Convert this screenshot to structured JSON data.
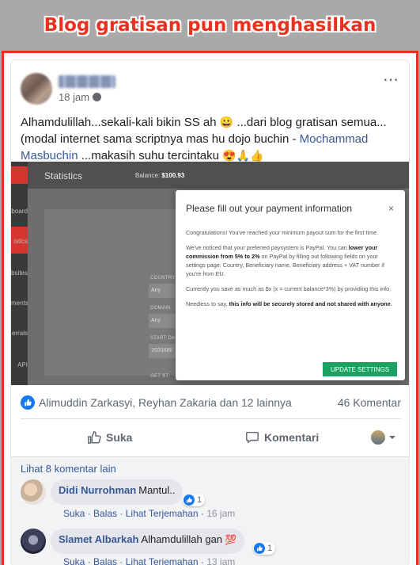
{
  "banner": {
    "title": "Blog gratisan pun menghasilkan"
  },
  "post": {
    "time": "18 jam",
    "more_icon": "⋯",
    "text_before": "Alhamdulillah...sekali-kali bikin SS ah ",
    "text_mid": " ...dari blog gratisan semua... (modal internet sama scriptnya mas hu dojo buchin - ",
    "mention": "Mochammad Masbuchin",
    "text_after": " ...makasih suhu tercintaku ",
    "emoji_1": "😀",
    "emoji_2": "😍🙏👍"
  },
  "screenshot": {
    "page_title": "Statistics",
    "balance_label": "Balance: ",
    "balance_value": "$100.93",
    "sidebar": [
      "board",
      "istics",
      "bsites",
      "ments",
      "errals",
      "API"
    ],
    "fields": [
      "COUNTRY",
      "DOMAIN",
      "START DA"
    ],
    "field_values": [
      "Any",
      "Any",
      "2020/06/"
    ],
    "get_label": "GET ST",
    "modal": {
      "title": "Please fill out your payment information",
      "close": "×",
      "p1": "Congratulations! You've reached your minimum payout sum for the first time.",
      "p2a": "We've noticed that your preferred paysystem is PayPal. You can ",
      "p2b": "lower your commission from 5% to 2%",
      "p2c": " on PayPal by filling out following fields on your settings page: Country, Beneficiary name, Beneficiary address + VAT number if you're from EU.",
      "p3": "Currently you save as much as $x (x = current balance*3%) by providing this info.",
      "p4a": "Needless to say, ",
      "p4b": "this info will be securely stored and not shared with anyone",
      "p4c": ".",
      "button": "UPDATE SETTINGS"
    }
  },
  "reactions": {
    "names": "Alimuddin Zarkasyi, Reyhan Zakaria dan 12 lainnya",
    "comment_count": "46 Komentar"
  },
  "actions": {
    "like": "Suka",
    "comment": "Komentari"
  },
  "comments": {
    "more": "Lihat 8 komentar lain",
    "items": [
      {
        "name": "Didi Nurrohman",
        "text": "Mantul..",
        "reactions": "1",
        "like": "Suka",
        "reply": "Balas",
        "translate": "Lihat Terjemahan",
        "time": "16 jam"
      },
      {
        "name": "Slamet Albarkah",
        "text": "Alhamdulillah gan",
        "emoji": "💯",
        "reactions": "1",
        "like": "Suka",
        "reply": "Balas",
        "translate": "Lihat Terjemahan",
        "time": "13 jam"
      }
    ]
  },
  "colors": {
    "accent_red": "#e8321f",
    "facebook_blue": "#385898",
    "update_green": "#1aa260"
  }
}
